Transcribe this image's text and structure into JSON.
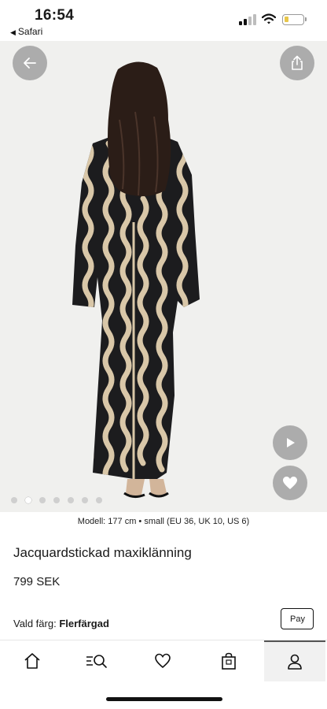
{
  "status_bar": {
    "time": "16:54",
    "back_app": "Safari"
  },
  "gallery": {
    "image_count": 7,
    "active_index": 1
  },
  "product": {
    "model_info": "Modell: 177 cm • small (EU 36, UK 10, US 6)",
    "name": "Jacquardstickad maxiklänning",
    "price": "799 SEK",
    "color_label": "Vald färg:",
    "color_value": "Flerfärgad",
    "apple_pay": "Pay"
  },
  "icons": {
    "back": "arrow-left-icon",
    "share": "share-icon",
    "play": "play-icon",
    "favorite": "heart-icon",
    "nav": [
      "home-icon",
      "search-menu-icon",
      "heart-icon",
      "bag-icon",
      "profile-icon"
    ]
  },
  "colors": {
    "dress_dark": "#1c1c1e",
    "dress_light": "#d9c7a8",
    "image_bg": "#f0f0ee"
  }
}
